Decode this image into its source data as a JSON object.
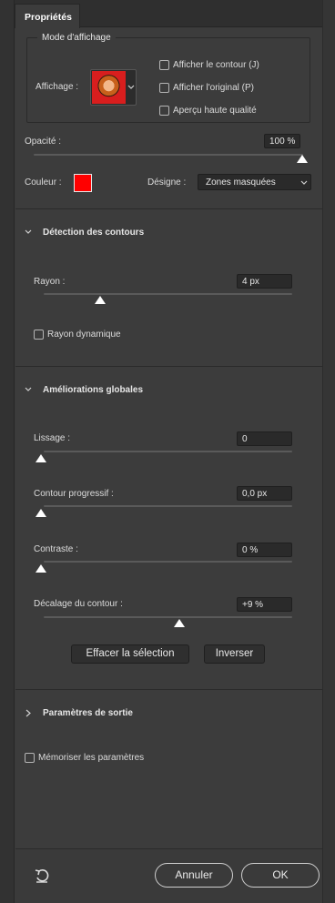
{
  "tab": {
    "label": "Propriétés"
  },
  "display_mode": {
    "group_label": "Mode d'affichage",
    "view_label": "Affichage :",
    "options": [
      {
        "label": "Afficher le contour (J)",
        "checked": false
      },
      {
        "label": "Afficher l'original (P)",
        "checked": false
      },
      {
        "label": "Aperçu haute qualité",
        "checked": false
      }
    ]
  },
  "opacity": {
    "label": "Opacité :",
    "value": "100 %"
  },
  "color": {
    "label": "Couleur :",
    "swatch": "#ff0000"
  },
  "designate": {
    "label": "Désigne :",
    "value": "Zones masquées"
  },
  "edge_detection": {
    "title": "Détection des contours",
    "radius_label": "Rayon :",
    "radius_value": "4 px",
    "radius_level": 0.23,
    "smart_radius_label": "Rayon dynamique",
    "smart_radius_checked": false
  },
  "global": {
    "title": "Améliorations globales",
    "sliders": [
      {
        "label": "Lissage :",
        "value": "0",
        "level": 0.0
      },
      {
        "label": "Contour progressif :",
        "value": "0,0 px",
        "level": 0.0
      },
      {
        "label": "Contraste :",
        "value": "0 %",
        "level": 0.0
      },
      {
        "label": "Décalage du contour :",
        "value": "+9 %",
        "level": 0.55
      }
    ],
    "clear_button": "Effacer la sélection",
    "invert_button": "Inverser"
  },
  "output": {
    "title": "Paramètres de sortie"
  },
  "remember": {
    "label": "Mémoriser les paramètres",
    "checked": false
  },
  "footer": {
    "cancel": "Annuler",
    "ok": "OK"
  },
  "icons": {
    "reset": "reset-icon",
    "chevron": "chevron-down-icon"
  }
}
